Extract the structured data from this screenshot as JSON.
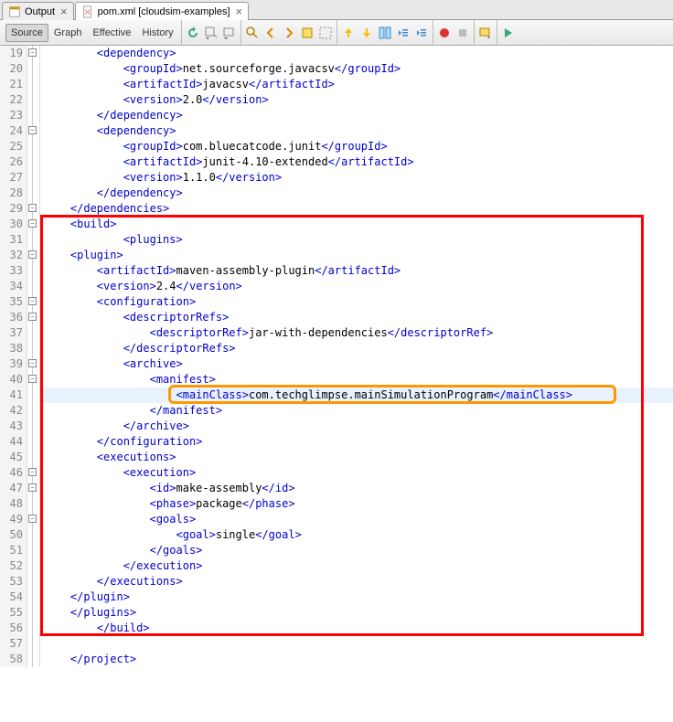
{
  "tabs": [
    {
      "label": "Output",
      "active": false
    },
    {
      "label": "pom.xml [cloudsim-examples]",
      "active": true
    }
  ],
  "toolbar": {
    "modes": [
      "Source",
      "Graph",
      "Effective",
      "History"
    ],
    "active_mode": "Source"
  },
  "first_line": 19,
  "last_line": 58,
  "fold_minus_lines": [
    19,
    24,
    29,
    30,
    32,
    35,
    36,
    39,
    40,
    46,
    47,
    49
  ],
  "code_lines": [
    {
      "n": 19,
      "indent": 8,
      "parts": [
        [
          "t",
          "<dependency>"
        ]
      ]
    },
    {
      "n": 20,
      "indent": 12,
      "parts": [
        [
          "t",
          "<groupId>"
        ],
        [
          "v",
          "net.sourceforge.javacsv"
        ],
        [
          "t",
          "</groupId>"
        ]
      ]
    },
    {
      "n": 21,
      "indent": 12,
      "parts": [
        [
          "t",
          "<artifactId>"
        ],
        [
          "v",
          "javacsv"
        ],
        [
          "t",
          "</artifactId>"
        ]
      ]
    },
    {
      "n": 22,
      "indent": 12,
      "parts": [
        [
          "t",
          "<version>"
        ],
        [
          "v",
          "2.0"
        ],
        [
          "t",
          "</version>"
        ]
      ]
    },
    {
      "n": 23,
      "indent": 8,
      "parts": [
        [
          "t",
          "</dependency>"
        ]
      ]
    },
    {
      "n": 24,
      "indent": 8,
      "parts": [
        [
          "t",
          "<dependency>"
        ]
      ]
    },
    {
      "n": 25,
      "indent": 12,
      "parts": [
        [
          "t",
          "<groupId>"
        ],
        [
          "v",
          "com.bluecatcode.junit"
        ],
        [
          "t",
          "</groupId>"
        ]
      ]
    },
    {
      "n": 26,
      "indent": 12,
      "parts": [
        [
          "t",
          "<artifactId>"
        ],
        [
          "v",
          "junit-4.10-extended"
        ],
        [
          "t",
          "</artifactId>"
        ]
      ]
    },
    {
      "n": 27,
      "indent": 12,
      "parts": [
        [
          "t",
          "<version>"
        ],
        [
          "v",
          "1.1.0"
        ],
        [
          "t",
          "</version>"
        ]
      ]
    },
    {
      "n": 28,
      "indent": 8,
      "parts": [
        [
          "t",
          "</dependency>"
        ]
      ]
    },
    {
      "n": 29,
      "indent": 4,
      "parts": [
        [
          "t",
          "</dependencies>"
        ]
      ]
    },
    {
      "n": 30,
      "indent": 4,
      "parts": [
        [
          "t",
          "<build>"
        ]
      ]
    },
    {
      "n": 31,
      "indent": 12,
      "parts": [
        [
          "t",
          "<plugins>"
        ]
      ]
    },
    {
      "n": 32,
      "indent": 4,
      "parts": [
        [
          "t",
          "<plugin>"
        ]
      ]
    },
    {
      "n": 33,
      "indent": 8,
      "parts": [
        [
          "t",
          "<artifactId>"
        ],
        [
          "v",
          "maven-assembly-plugin"
        ],
        [
          "t",
          "</artifactId>"
        ]
      ]
    },
    {
      "n": 34,
      "indent": 8,
      "parts": [
        [
          "t",
          "<version>"
        ],
        [
          "v",
          "2.4"
        ],
        [
          "t",
          "</version>"
        ]
      ]
    },
    {
      "n": 35,
      "indent": 8,
      "parts": [
        [
          "t",
          "<configuration>"
        ]
      ]
    },
    {
      "n": 36,
      "indent": 12,
      "parts": [
        [
          "t",
          "<descriptorRefs>"
        ]
      ]
    },
    {
      "n": 37,
      "indent": 16,
      "parts": [
        [
          "t",
          "<descriptorRef>"
        ],
        [
          "v",
          "jar-with-dependencies"
        ],
        [
          "t",
          "</descriptorRef>"
        ]
      ]
    },
    {
      "n": 38,
      "indent": 12,
      "parts": [
        [
          "t",
          "</descriptorRefs>"
        ]
      ]
    },
    {
      "n": 39,
      "indent": 12,
      "parts": [
        [
          "t",
          "<archive>"
        ]
      ]
    },
    {
      "n": 40,
      "indent": 16,
      "parts": [
        [
          "t",
          "<manifest>"
        ]
      ]
    },
    {
      "n": 41,
      "indent": 20,
      "parts": [
        [
          "t",
          "<mainClass>"
        ],
        [
          "v",
          "com.techglimpse.mainSimulationProgram"
        ],
        [
          "t",
          "</mainClass>"
        ]
      ],
      "hl": true
    },
    {
      "n": 42,
      "indent": 16,
      "parts": [
        [
          "t",
          "</manifest>"
        ]
      ]
    },
    {
      "n": 43,
      "indent": 12,
      "parts": [
        [
          "t",
          "</archive>"
        ]
      ]
    },
    {
      "n": 44,
      "indent": 8,
      "parts": [
        [
          "t",
          "</configuration>"
        ]
      ]
    },
    {
      "n": 45,
      "indent": 8,
      "parts": [
        [
          "t",
          "<executions>"
        ]
      ]
    },
    {
      "n": 46,
      "indent": 12,
      "parts": [
        [
          "t",
          "<execution>"
        ]
      ]
    },
    {
      "n": 47,
      "indent": 16,
      "parts": [
        [
          "t",
          "<id>"
        ],
        [
          "v",
          "make-assembly"
        ],
        [
          "t",
          "</id>"
        ]
      ]
    },
    {
      "n": 48,
      "indent": 16,
      "parts": [
        [
          "t",
          "<phase>"
        ],
        [
          "v",
          "package"
        ],
        [
          "t",
          "</phase>"
        ]
      ]
    },
    {
      "n": 49,
      "indent": 16,
      "parts": [
        [
          "t",
          "<goals>"
        ]
      ]
    },
    {
      "n": 50,
      "indent": 20,
      "parts": [
        [
          "t",
          "<goal>"
        ],
        [
          "v",
          "single"
        ],
        [
          "t",
          "</goal>"
        ]
      ]
    },
    {
      "n": 51,
      "indent": 16,
      "parts": [
        [
          "t",
          "</goals>"
        ]
      ]
    },
    {
      "n": 52,
      "indent": 12,
      "parts": [
        [
          "t",
          "</execution>"
        ]
      ]
    },
    {
      "n": 53,
      "indent": 8,
      "parts": [
        [
          "t",
          "</executions>"
        ]
      ]
    },
    {
      "n": 54,
      "indent": 4,
      "parts": [
        [
          "t",
          "</plugin>"
        ]
      ]
    },
    {
      "n": 55,
      "indent": 4,
      "parts": [
        [
          "t",
          "</plugins>"
        ]
      ]
    },
    {
      "n": 56,
      "indent": 8,
      "parts": [
        [
          "t",
          "</build>"
        ]
      ]
    },
    {
      "n": 57,
      "indent": 0,
      "parts": []
    },
    {
      "n": 58,
      "indent": 4,
      "parts": [
        [
          "t",
          "</project>"
        ]
      ]
    }
  ],
  "highlight": {
    "red_start_line": 30,
    "red_end_line": 56,
    "orange_line": 41
  },
  "icons": {
    "toolbar": [
      "refresh",
      "dropdown1",
      "dropdown2",
      "sep",
      "find",
      "back-arrow",
      "forward-arrow",
      "swap",
      "select-rect",
      "sep",
      "nav-up",
      "nav-down",
      "diff",
      "outdent",
      "indent",
      "sep",
      "record",
      "stop",
      "sep",
      "format-down",
      "sep",
      "run-arrow"
    ]
  }
}
